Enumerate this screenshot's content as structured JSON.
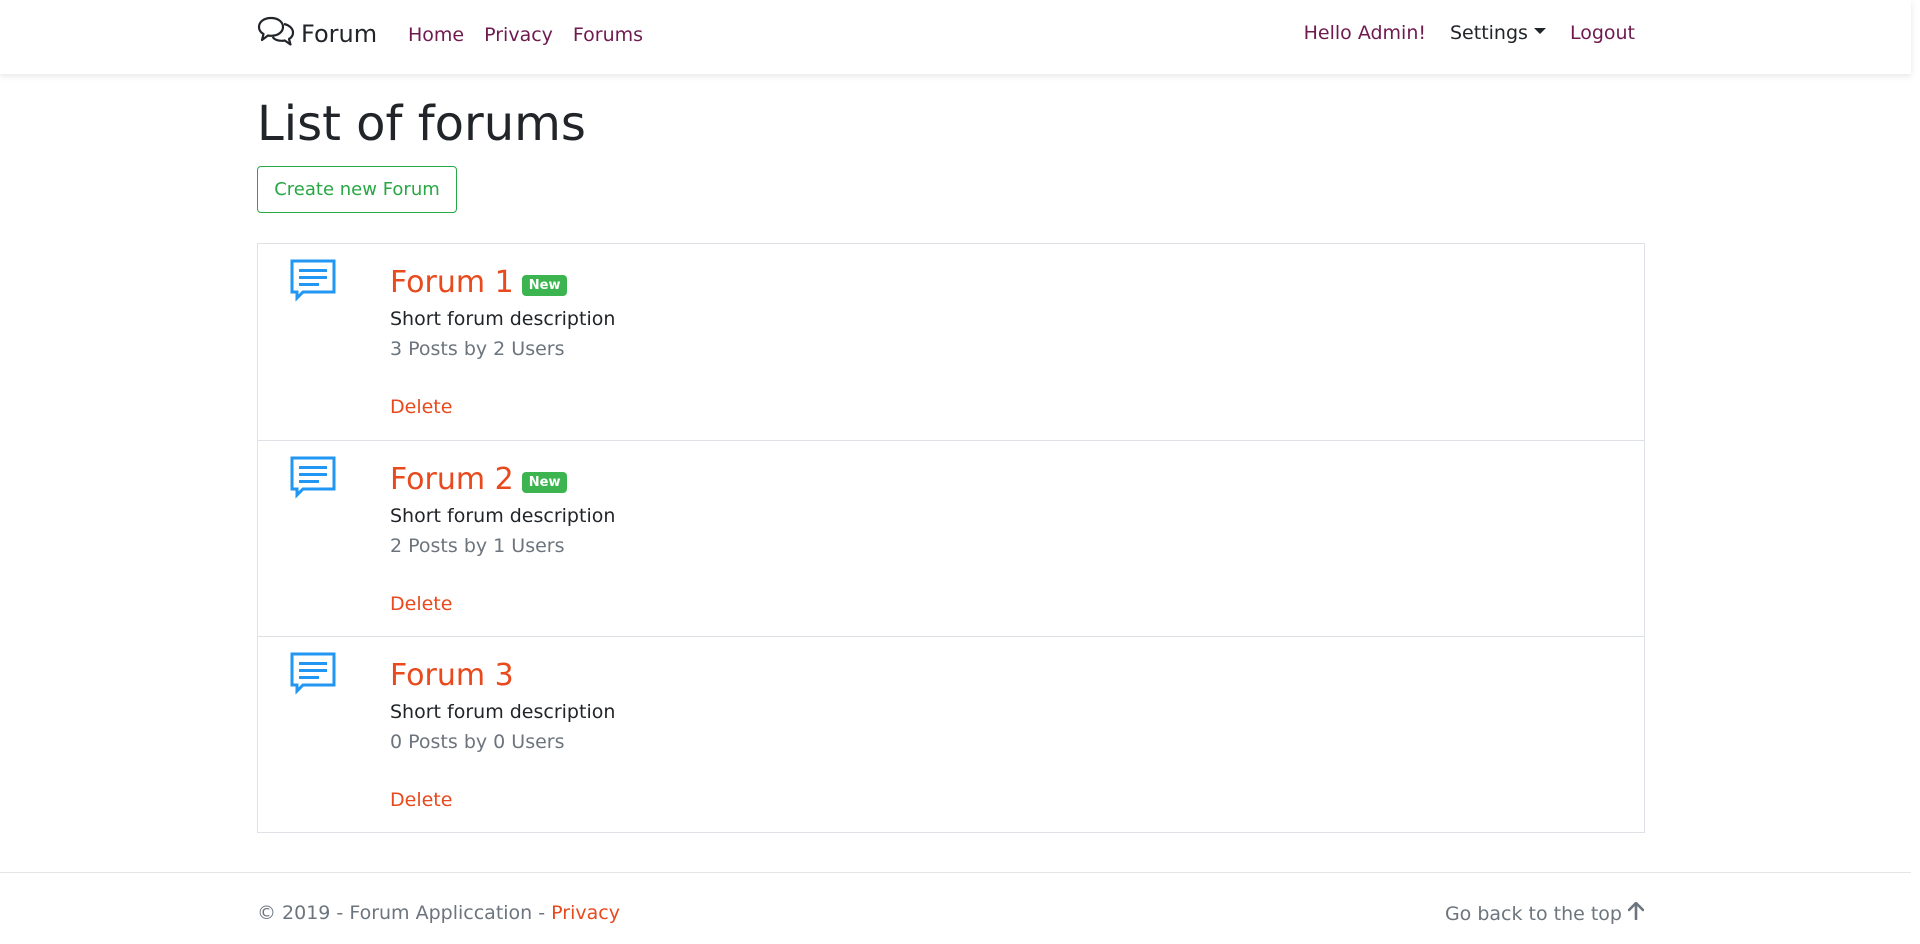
{
  "navbar": {
    "brand": "Forum",
    "links": [
      "Home",
      "Privacy",
      "Forums"
    ],
    "greeting": "Hello Admin!",
    "settings": "Settings",
    "logout": "Logout"
  },
  "main": {
    "title": "List of forums",
    "create_button": "Create new Forum",
    "forums": [
      {
        "name": "Forum 1",
        "badge": "New",
        "description": "Short forum description",
        "stats": "3 Posts by 2 Users",
        "delete": "Delete"
      },
      {
        "name": "Forum 2",
        "badge": "New",
        "description": "Short forum description",
        "stats": "2 Posts by 1 Users",
        "delete": "Delete"
      },
      {
        "name": "Forum 3",
        "badge": "",
        "description": "Short forum description",
        "stats": "0 Posts by 0 Users",
        "delete": "Delete"
      }
    ]
  },
  "footer": {
    "copyright": "© 2019 - Forum Appliccation - ",
    "privacy": "Privacy",
    "back_to_top": "Go back to the top"
  },
  "colors": {
    "nav_link": "#6f1a4f",
    "accent": "#e8491d",
    "success": "#28a745",
    "forum_icon": "#2196f3"
  },
  "icons": {
    "brand": "speech-bubbles-icon",
    "forum": "message-icon",
    "back_top": "arrow-up-icon"
  }
}
